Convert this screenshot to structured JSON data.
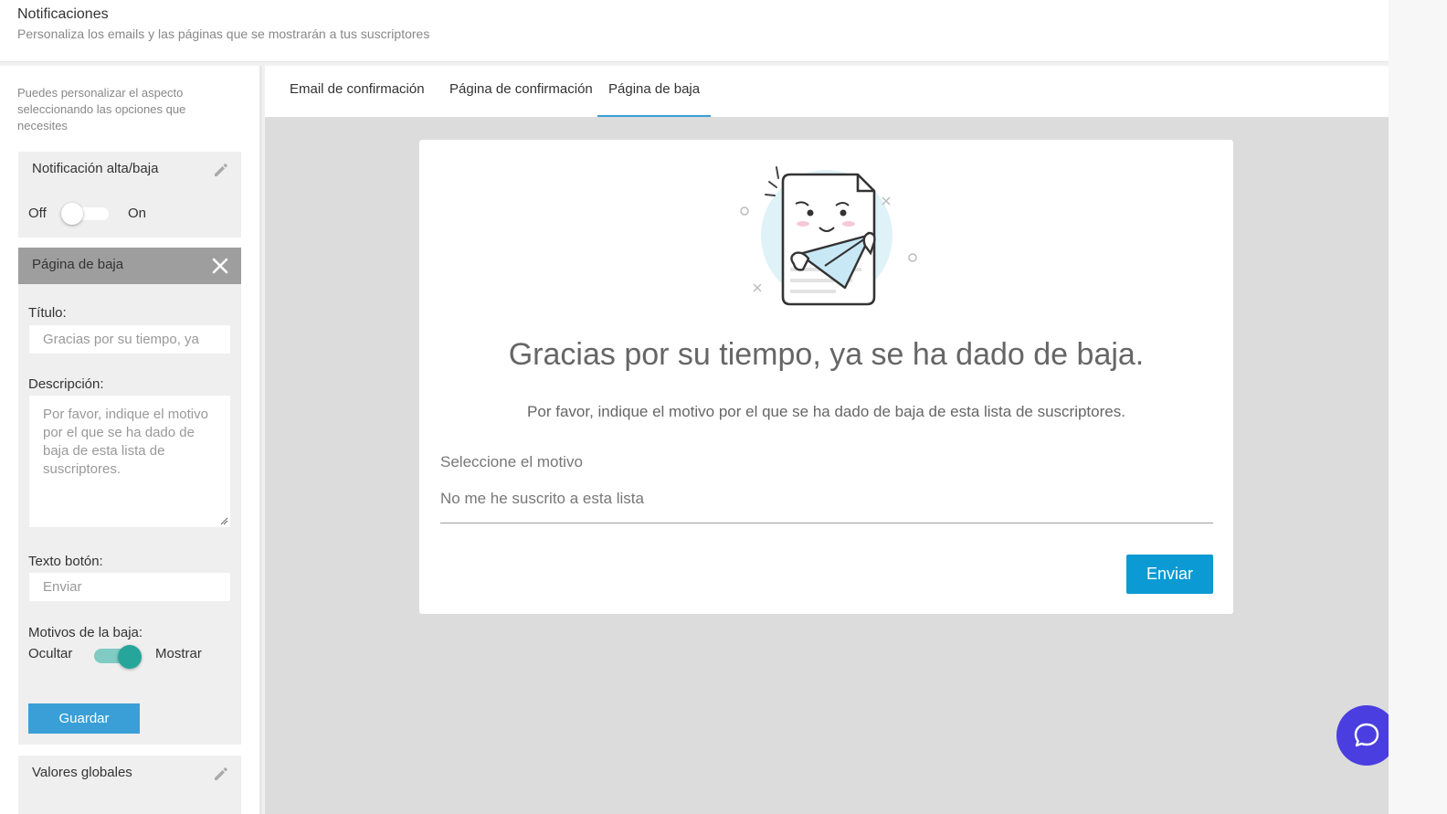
{
  "header": {
    "title": "Notificaciones",
    "subtitle": "Personaliza los emails y las páginas que se mostrarán a tus suscriptores"
  },
  "sidebar": {
    "hint": "Puedes personalizar el aspecto seleccionando las opciones que necesites",
    "notification_panel": {
      "title": "Notificación alta/baja",
      "off_label": "Off",
      "on_label": "On",
      "enabled": false
    },
    "unsubscribe_panel": {
      "title": "Página de baja",
      "title_label": "Título:",
      "title_value": "Gracias por su tiempo, ya",
      "description_label": "Descripción:",
      "description_value": "Por favor, indique el motivo por el que se ha dado de baja de esta lista de suscriptores.",
      "button_text_label": "Texto botón:",
      "button_text_value": "Enviar",
      "reasons_label": "Motivos de la baja:",
      "hide_label": "Ocultar",
      "show_label": "Mostrar",
      "reasons_shown": true,
      "save_label": "Guardar"
    },
    "global_panel": {
      "title": "Valores globales"
    }
  },
  "tabs": [
    {
      "label": "Email de confirmación",
      "active": false
    },
    {
      "label": "Página de confirmación",
      "active": false
    },
    {
      "label": "Página de baja",
      "active": true
    }
  ],
  "preview": {
    "title": "Gracias por su tiempo, ya se ha dado de baja.",
    "description": "Por favor, indique el motivo por el que se ha dado de baja de esta lista de suscriptores.",
    "select_label": "Seleccione el motivo",
    "select_value": "No me he suscrito a esta lista",
    "submit_label": "Enviar"
  },
  "colors": {
    "accent": "#3a9fd6",
    "submit": "#0b9ad3",
    "toggle_on": "#26a69a",
    "chat": "#4a3ee0"
  }
}
